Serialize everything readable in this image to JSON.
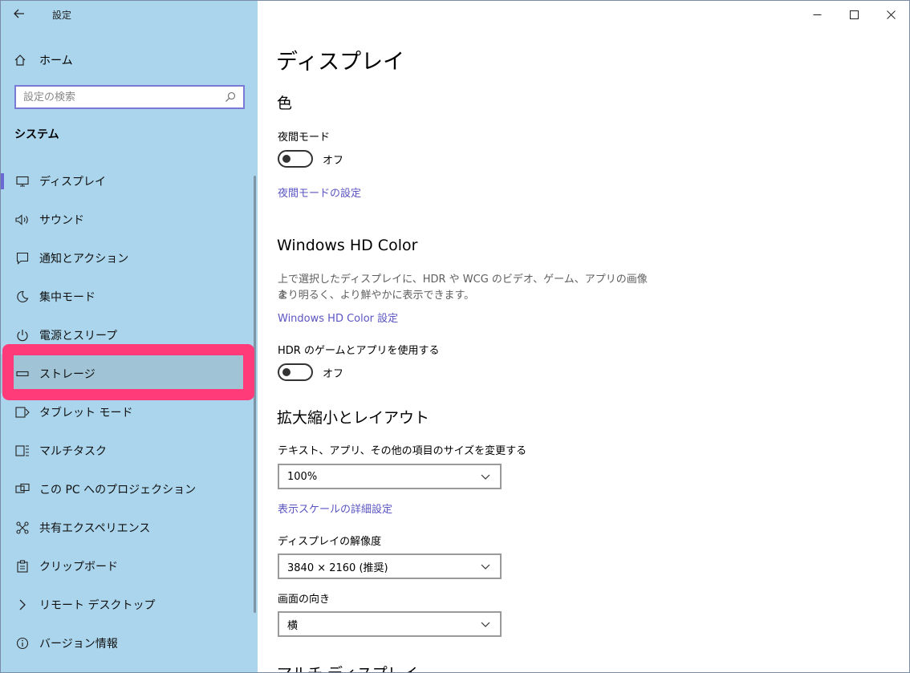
{
  "window": {
    "app_title": "設定"
  },
  "sidebar": {
    "home_label": "ホーム",
    "search_placeholder": "設定の検索",
    "section_heading": "システム",
    "items": [
      {
        "label": "ディスプレイ",
        "icon": "monitor-icon"
      },
      {
        "label": "サウンド",
        "icon": "speaker-icon"
      },
      {
        "label": "通知とアクション",
        "icon": "notification-icon"
      },
      {
        "label": "集中モード",
        "icon": "moon-icon"
      },
      {
        "label": "電源とスリープ",
        "icon": "power-icon"
      },
      {
        "label": "ストレージ",
        "icon": "storage-icon"
      },
      {
        "label": "タブレット モード",
        "icon": "tablet-icon"
      },
      {
        "label": "マルチタスク",
        "icon": "multitask-icon"
      },
      {
        "label": "この PC へのプロジェクション",
        "icon": "projection-icon"
      },
      {
        "label": "共有エクスペリエンス",
        "icon": "shared-icon"
      },
      {
        "label": "クリップボード",
        "icon": "clipboard-icon"
      },
      {
        "label": "リモート デスクトップ",
        "icon": "remote-icon"
      },
      {
        "label": "バージョン情報",
        "icon": "info-icon"
      }
    ],
    "selected_item": "ディスプレイ",
    "highlighted_item": "ストレージ",
    "accent_color": "#6b69d6",
    "background_color": "#abd5ec",
    "highlight_frame_color": "#ff3b7a"
  },
  "main": {
    "page_title": "ディスプレイ",
    "color_section": {
      "title": "色",
      "night_mode_label": "夜間モード",
      "night_mode_state": "オフ",
      "night_mode_link": "夜間モードの設定"
    },
    "hdr_section": {
      "title": "Windows HD Color",
      "description_line1": "上で選択したディスプレイに、HDR や WCG のビデオ、ゲーム、アプリの画像を",
      "description_line2": "より明るく、より鮮やかに表示できます。",
      "settings_link": "Windows HD Color 設定",
      "hdr_toggle_label": "HDR のゲームとアプリを使用する",
      "hdr_toggle_state": "オフ"
    },
    "scale_section": {
      "title": "拡大縮小とレイアウト",
      "text_size_label": "テキスト、アプリ、その他の項目のサイズを変更する",
      "text_size_value": "100%",
      "advanced_scale_link": "表示スケールの詳細設定",
      "resolution_label": "ディスプレイの解像度",
      "resolution_value": "3840 × 2160 (推奨)",
      "orientation_label": "画面の向き",
      "orientation_value": "横"
    },
    "multi_display_title": "マルチ ディスプレイ",
    "link_color": "#5a55c2"
  }
}
